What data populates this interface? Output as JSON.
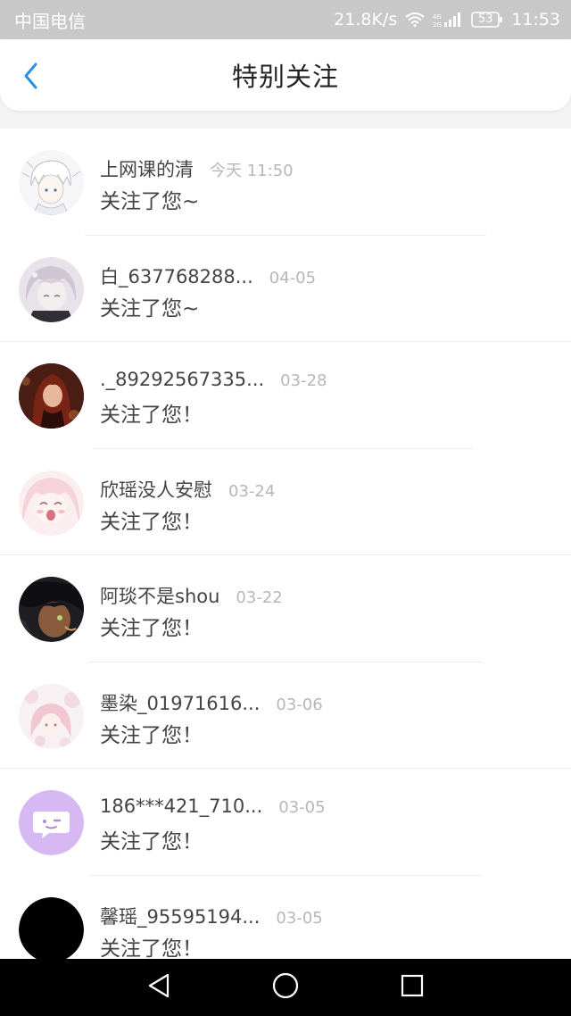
{
  "status_bar": {
    "carrier": "中国电信",
    "net_speed": "21.8K/s",
    "battery": "53",
    "time": "11:53"
  },
  "header": {
    "title": "特别关注"
  },
  "items": [
    {
      "name": "上网课的清",
      "date": "今天 11:50",
      "message": "关注了您~"
    },
    {
      "name": "白_637768288...",
      "date": "04-05",
      "message": "关注了您~"
    },
    {
      "name": "._89292567335...",
      "date": "03-28",
      "message": "关注了您！"
    },
    {
      "name": "欣瑶没人安慰",
      "date": "03-24",
      "message": "关注了您！"
    },
    {
      "name": "阿琰不是shou",
      "date": "03-22",
      "message": "关注了您！"
    },
    {
      "name": "墨染_01971616...",
      "date": "03-06",
      "message": "关注了您！"
    },
    {
      "name": "186***421_710...",
      "date": "03-05",
      "message": "关注了您！"
    },
    {
      "name": "馨瑶_95595194...",
      "date": "03-05",
      "message": "关注了您！"
    }
  ],
  "colors": {
    "accent": "#2b90e8",
    "status_bar_bg": "#c8c8c8",
    "nav_bar_bg": "#000000",
    "chat_avatar": "#d6b8f2"
  }
}
